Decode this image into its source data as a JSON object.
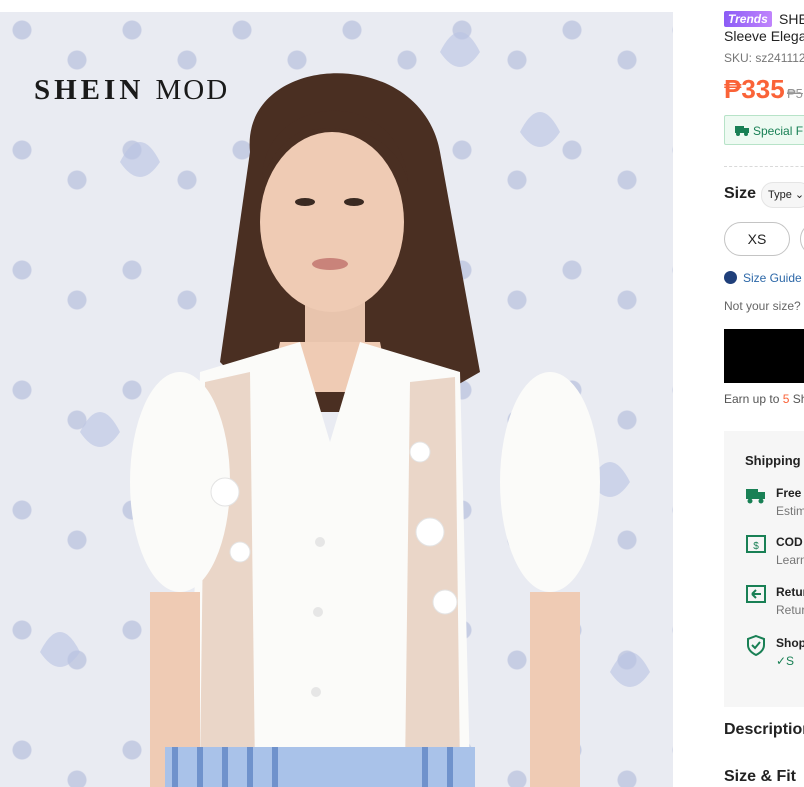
{
  "image": {
    "brand_main": "SHEIN",
    "brand_sub": "MOD"
  },
  "product": {
    "badge": "Trends",
    "title_line1": "SHE",
    "title_line2": "Sleeve Elega",
    "sku": "SKU: sz2411129",
    "price": "₱335",
    "old_price": "₱5",
    "promo": "Special F"
  },
  "size": {
    "label": "Size",
    "type_select": "Type",
    "options": [
      "XS"
    ],
    "guide": "Size Guide",
    "not_your_size": "Not your size?"
  },
  "earn": {
    "prefix": "Earn up to ",
    "points": "5",
    "suffix": " Sh"
  },
  "shipping": {
    "title": "Shipping",
    "rows": [
      {
        "title": "Free",
        "sub": "Estim"
      },
      {
        "title": "COD",
        "sub": "Learn"
      },
      {
        "title": "Retur",
        "sub": "Retur"
      },
      {
        "title": "Shop",
        "sub": "✓S"
      }
    ]
  },
  "sections": {
    "description": "Description",
    "size_fit": "Size & Fit"
  },
  "colors": {
    "price": "#fa6338",
    "promo_green": "#198055",
    "cart_button": "#000000"
  }
}
